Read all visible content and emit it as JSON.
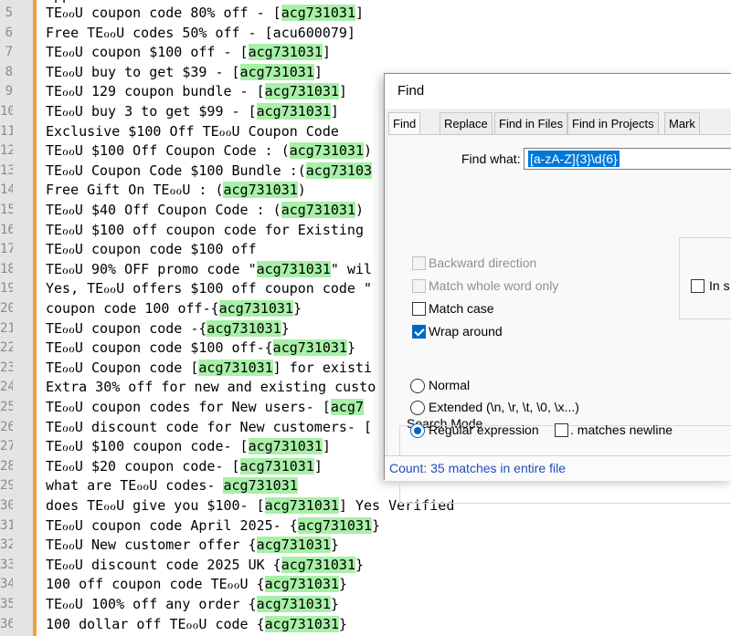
{
  "editor": {
    "partial_top_line": "    upp",
    "lines": [
      {
        "num": "5",
        "segments": [
          {
            "t": "TEℴℴU coupon code 80% off - ["
          },
          {
            "t": "acg731031",
            "hl": true
          },
          {
            "t": "]"
          }
        ]
      },
      {
        "num": "6",
        "segments": [
          {
            "t": "Free TEℴℴU codes 50% off - [acu600079]"
          }
        ]
      },
      {
        "num": "7",
        "segments": [
          {
            "t": "TEℴℴU coupon $100 off - ["
          },
          {
            "t": "acg731031",
            "hl": true
          },
          {
            "t": "]"
          }
        ]
      },
      {
        "num": "8",
        "segments": [
          {
            "t": "TEℴℴU buy to get $39 - ["
          },
          {
            "t": "acg731031",
            "hl": true
          },
          {
            "t": "]"
          }
        ]
      },
      {
        "num": "9",
        "segments": [
          {
            "t": "TEℴℴU 129 coupon bundle - ["
          },
          {
            "t": "acg731031",
            "hl": true
          },
          {
            "t": "]"
          }
        ]
      },
      {
        "num": "10",
        "segments": [
          {
            "t": "TEℴℴU buy 3 to get $99 - ["
          },
          {
            "t": "acg731031",
            "hl": true
          },
          {
            "t": "]"
          }
        ]
      },
      {
        "num": "11",
        "segments": [
          {
            "t": "Exclusive $100 Off TEℴℴU Coupon Code"
          }
        ]
      },
      {
        "num": "12",
        "segments": [
          {
            "t": "TEℴℴU $100 Off Coupon Code : ("
          },
          {
            "t": "acg731031",
            "hl": true
          },
          {
            "t": ")"
          }
        ]
      },
      {
        "num": "13",
        "segments": [
          {
            "t": "TEℴℴU Coupon Code $100 Bundle :("
          },
          {
            "t": "acg73103",
            "hl": true
          }
        ]
      },
      {
        "num": "14",
        "segments": [
          {
            "t": "Free Gift On TEℴℴU : ("
          },
          {
            "t": "acg731031",
            "hl": true
          },
          {
            "t": ")"
          }
        ]
      },
      {
        "num": "15",
        "segments": [
          {
            "t": "TEℴℴU $40 Off Coupon Code : ("
          },
          {
            "t": "acg731031",
            "hl": true
          },
          {
            "t": ")"
          }
        ]
      },
      {
        "num": "16",
        "segments": [
          {
            "t": "TEℴℴU $100 off coupon code for Existing"
          }
        ]
      },
      {
        "num": "17",
        "segments": [
          {
            "t": "TEℴℴU coupon code $100 off"
          }
        ]
      },
      {
        "num": "18",
        "segments": [
          {
            "t": "TEℴℴU 90% OFF promo code \""
          },
          {
            "t": "acg731031",
            "hl": true
          },
          {
            "t": "\" wil"
          }
        ]
      },
      {
        "num": "19",
        "segments": [
          {
            "t": "Yes, TEℴℴU offers $100 off coupon code \""
          }
        ]
      },
      {
        "num": "20",
        "segments": [
          {
            "t": "coupon code 100 off-{"
          },
          {
            "t": "acg731031",
            "hl": true
          },
          {
            "t": "}"
          }
        ]
      },
      {
        "num": "21",
        "segments": [
          {
            "t": "TEℴℴU coupon code -{"
          },
          {
            "t": "acg731031",
            "hl": true
          },
          {
            "t": "}"
          }
        ]
      },
      {
        "num": "22",
        "segments": [
          {
            "t": "TEℴℴU coupon code $100 off-{"
          },
          {
            "t": "acg731031",
            "hl": true
          },
          {
            "t": "}"
          }
        ]
      },
      {
        "num": "23",
        "segments": [
          {
            "t": "TEℴℴU Coupon code ["
          },
          {
            "t": "acg731031",
            "hl": true
          },
          {
            "t": "] for existi"
          }
        ]
      },
      {
        "num": "24",
        "segments": [
          {
            "t": "Extra 30% off for new and existing custo"
          }
        ]
      },
      {
        "num": "25",
        "segments": [
          {
            "t": "TEℴℴU coupon codes for New users- ["
          },
          {
            "t": "acg7",
            "hl": true
          }
        ]
      },
      {
        "num": "26",
        "segments": [
          {
            "t": "TEℴℴU discount code for New customers- ["
          }
        ]
      },
      {
        "num": "27",
        "segments": [
          {
            "t": "TEℴℴU $100 coupon code- ["
          },
          {
            "t": "acg731031",
            "hl": true
          },
          {
            "t": "]"
          }
        ]
      },
      {
        "num": "28",
        "segments": [
          {
            "t": "TEℴℴU $20 coupon code- ["
          },
          {
            "t": "acg731031",
            "hl": true
          },
          {
            "t": "]"
          }
        ]
      },
      {
        "num": "29",
        "segments": [
          {
            "t": "what are TEℴℴU codes- "
          },
          {
            "t": "acg731031",
            "hl": true
          }
        ]
      },
      {
        "num": "30",
        "segments": [
          {
            "t": "does TEℴℴU give you $100- ["
          },
          {
            "t": "acg731031",
            "hl": true
          },
          {
            "t": "] Yes Verified"
          }
        ]
      },
      {
        "num": "31",
        "segments": [
          {
            "t": "TEℴℴU coupon code April 2025- {"
          },
          {
            "t": "acg731031",
            "hl": true
          },
          {
            "t": "}"
          }
        ]
      },
      {
        "num": "32",
        "segments": [
          {
            "t": "TEℴℴU New customer offer {"
          },
          {
            "t": "acg731031",
            "hl": true
          },
          {
            "t": "}"
          }
        ]
      },
      {
        "num": "33",
        "segments": [
          {
            "t": "TEℴℴU discount code 2025 UK {"
          },
          {
            "t": "acg731031",
            "hl": true
          },
          {
            "t": "}"
          }
        ]
      },
      {
        "num": "34",
        "segments": [
          {
            "t": "100 off coupon code TEℴℴU {"
          },
          {
            "t": "acg731031",
            "hl": true
          },
          {
            "t": "}"
          }
        ]
      },
      {
        "num": "35",
        "segments": [
          {
            "t": "TEℴℴU 100% off any order {"
          },
          {
            "t": "acg731031",
            "hl": true
          },
          {
            "t": "}"
          }
        ]
      },
      {
        "num": "36",
        "segments": [
          {
            "t": "100 dollar off TEℴℴU code {"
          },
          {
            "t": "acg731031",
            "hl": true
          },
          {
            "t": "}"
          }
        ]
      }
    ]
  },
  "find_dialog": {
    "title": "Find",
    "tabs": [
      "Find",
      "Replace",
      "Find in Files",
      "Find in Projects",
      "Mark"
    ],
    "active_tab": "Find",
    "find_what_label": "Find what:",
    "find_what_value": "[a-zA-Z]{3}\\d{6}",
    "in_selection_label": "In s",
    "options": [
      {
        "label": "Backward direction",
        "checked": false,
        "disabled": true
      },
      {
        "label": "Match whole word only",
        "checked": false,
        "disabled": true
      },
      {
        "label": "Match case",
        "checked": false,
        "disabled": false
      },
      {
        "label": "Wrap around",
        "checked": true,
        "disabled": false
      }
    ],
    "search_mode_title": "Search Mode",
    "search_modes": [
      {
        "label": "Normal",
        "selected": false
      },
      {
        "label": "Extended (\\n, \\r, \\t, \\0, \\x...)",
        "selected": false
      },
      {
        "label": "Regular expression",
        "selected": true
      }
    ],
    "matches_newline_label": ". matches newline",
    "status": "Count: 35 matches in entire file",
    "colors": {
      "highlight": "#a8f0a8",
      "selection": "#0078d7",
      "status_text": "#1f4fbf",
      "change_bar": "#f0a040"
    }
  }
}
